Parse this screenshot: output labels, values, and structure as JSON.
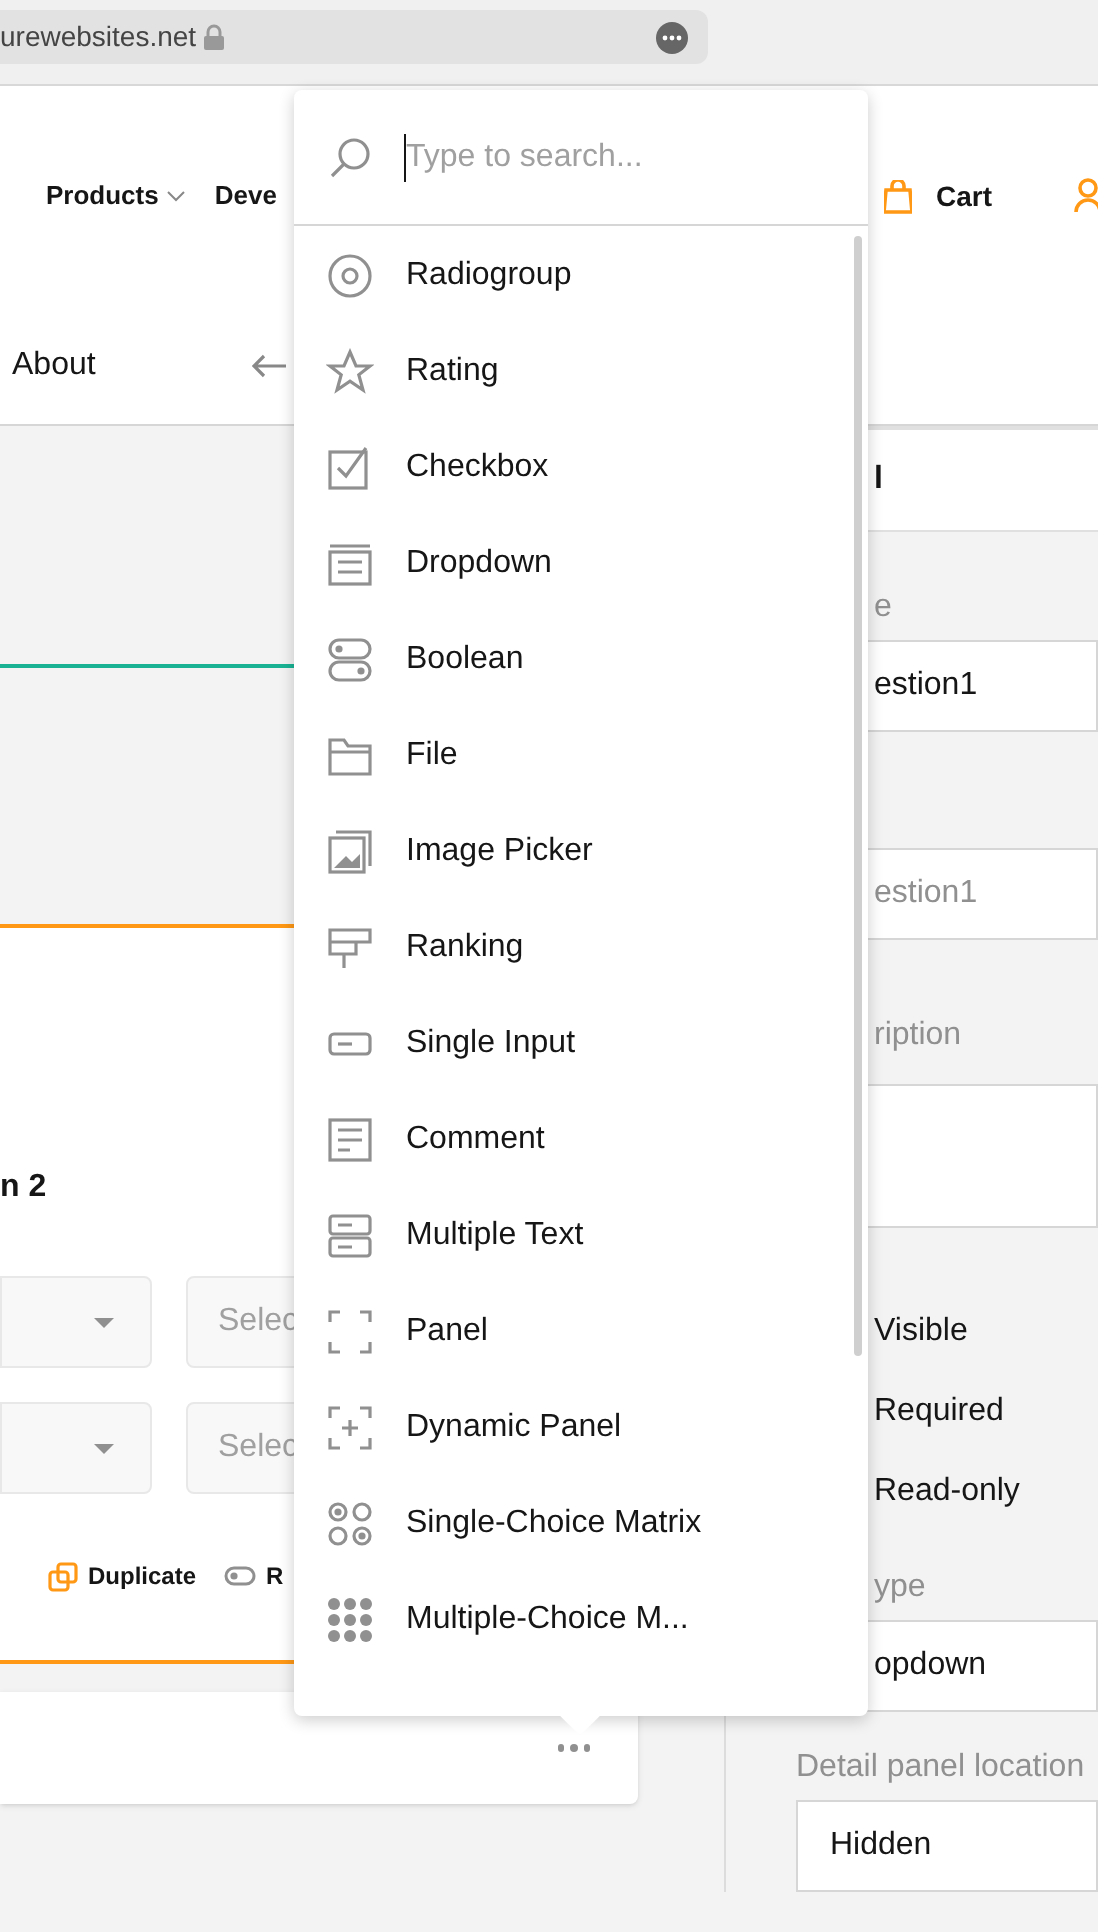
{
  "browser": {
    "url": "urewebsites.net"
  },
  "nav": {
    "items": [
      {
        "label": "Products",
        "dropdown": true
      },
      {
        "label": "Deve",
        "dropdown": false
      }
    ],
    "cart": "Cart"
  },
  "subnav": {
    "about": "About"
  },
  "question": {
    "title": "n 2",
    "dropdowns": [
      {
        "placeholder": "Selec"
      },
      {
        "placeholder": "Selec"
      }
    ],
    "actions": [
      {
        "label": "Duplicate",
        "kind": "duplicate"
      },
      {
        "label": "R",
        "kind": "toggle"
      }
    ]
  },
  "properties": [
    {
      "kind": "header",
      "text": "l"
    },
    {
      "kind": "label",
      "text": "e"
    },
    {
      "kind": "field",
      "value": "estion1"
    },
    {
      "kind": "blank"
    },
    {
      "kind": "field",
      "placeholder": "estion1"
    },
    {
      "kind": "label",
      "text": "ription"
    },
    {
      "kind": "textarea"
    },
    {
      "kind": "check",
      "text": "Visible"
    },
    {
      "kind": "check",
      "text": "Required"
    },
    {
      "kind": "check",
      "text": "Read-only"
    },
    {
      "kind": "label",
      "text": "ype"
    },
    {
      "kind": "field",
      "value": "opdown"
    },
    {
      "kind": "label",
      "text": "Detail panel location"
    },
    {
      "kind": "field",
      "value": "Hidden"
    }
  ],
  "toolbox": {
    "placeholder": "Type to search...",
    "items": [
      {
        "label": "Radiogroup"
      },
      {
        "label": "Rating"
      },
      {
        "label": "Checkbox"
      },
      {
        "label": "Dropdown"
      },
      {
        "label": "Boolean"
      },
      {
        "label": "File"
      },
      {
        "label": "Image Picker"
      },
      {
        "label": "Ranking"
      },
      {
        "label": "Single Input"
      },
      {
        "label": "Comment"
      },
      {
        "label": "Multiple Text"
      },
      {
        "label": "Panel"
      },
      {
        "label": "Dynamic Panel"
      },
      {
        "label": "Single-Choice Matrix"
      },
      {
        "label": "Multiple-Choice M..."
      }
    ]
  }
}
